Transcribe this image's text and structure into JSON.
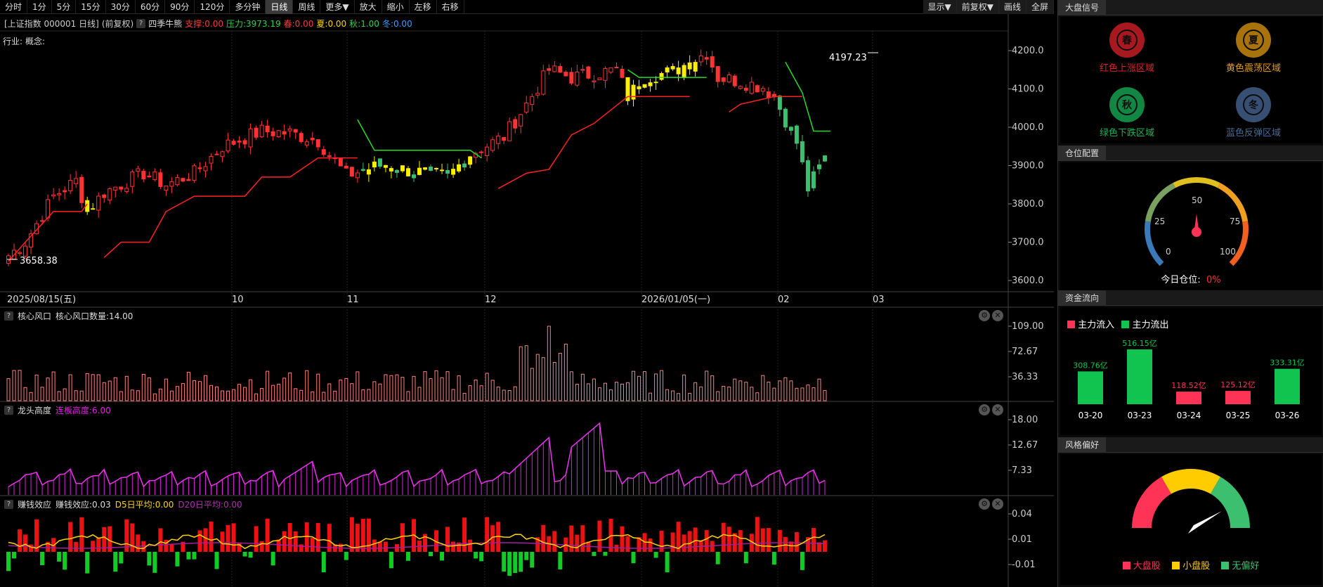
{
  "toolbar": {
    "periods": [
      "分时",
      "1分",
      "5分",
      "15分",
      "30分",
      "60分",
      "90分",
      "120分",
      "多分钟",
      "日线",
      "周线",
      "更多▼",
      "放大",
      "缩小",
      "左移",
      "右移"
    ],
    "active": "日线",
    "right": [
      "显示▼",
      "前复权▼",
      "画线",
      "全屏"
    ]
  },
  "info": {
    "title": "[上证指数 000001 日线]",
    "adjust": "(前复权)",
    "indicator": "四季牛熊",
    "support": "支撑:0.00",
    "resistance": "压力:3973.19",
    "spring": "春:0.00",
    "summer": "夏:0.00",
    "autumn": "秋:1.00",
    "winter": "冬:0.00",
    "industry": "行业:",
    "concept": "概念:"
  },
  "main_chart": {
    "y_ticks": [
      "4200.0",
      "4100.0",
      "4000.0",
      "3900.0",
      "3800.0",
      "3700.0",
      "3600.0"
    ],
    "high_label": "4197.23",
    "low_label": "3658.38",
    "x_labels": [
      "2025/08/15(五)",
      "10",
      "11",
      "12",
      "2026/01/05(一)",
      "02",
      "03"
    ]
  },
  "panels": {
    "core": {
      "name": "核心风口",
      "value": "核心风口数量:14.00",
      "ticks": [
        "109.00",
        "72.67",
        "36.33"
      ]
    },
    "dragon": {
      "name": "龙头高度",
      "value": "连板高度:6.00",
      "ticks": [
        "18.00",
        "12.67",
        "7.33"
      ]
    },
    "money": {
      "name": "赚钱效应",
      "value": "赚钱效应:0.03",
      "d5": "D5日平均:0.00",
      "d20": "D20日平均:0.00",
      "ticks": [
        "0.04",
        "0.01",
        "-0.01"
      ]
    }
  },
  "sidebar": {
    "signal_title": "大盘信号",
    "seasons": [
      {
        "label": "红色上涨区域",
        "char": "春",
        "color": "#e0202a"
      },
      {
        "label": "黄色震荡区域",
        "char": "夏",
        "color": "#e09a10"
      },
      {
        "label": "绿色下跌区域",
        "char": "秋",
        "color": "#19b35a"
      },
      {
        "label": "蓝色反弹区域",
        "char": "冬",
        "color": "#4a6a9a"
      }
    ],
    "position_title": "仓位配置",
    "gauge_ticks": [
      "0",
      "25",
      "50",
      "75",
      "100"
    ],
    "today_label": "今日仓位:",
    "today_value": "0%",
    "flow_title": "资金流向",
    "flow_legend_in": "主力流入",
    "flow_legend_out": "主力流出",
    "style_title": "风格偏好",
    "style_legend": [
      "大盘股",
      "小盘股",
      "无偏好"
    ]
  },
  "chart_data": [
    {
      "type": "bar",
      "title": "资金流向",
      "categories": [
        "03-20",
        "03-23",
        "03-24",
        "03-25",
        "03-26"
      ],
      "values": [
        308.76,
        516.15,
        118.52,
        125.12,
        333.31
      ],
      "value_labels": [
        "308.76亿",
        "516.15亿",
        "118.52亿",
        "125.12亿",
        "333.31亿"
      ],
      "direction": [
        "out",
        "out",
        "in",
        "in",
        "out"
      ],
      "colors": {
        "in": "#ff3333",
        "out": "#11c450"
      }
    }
  ]
}
